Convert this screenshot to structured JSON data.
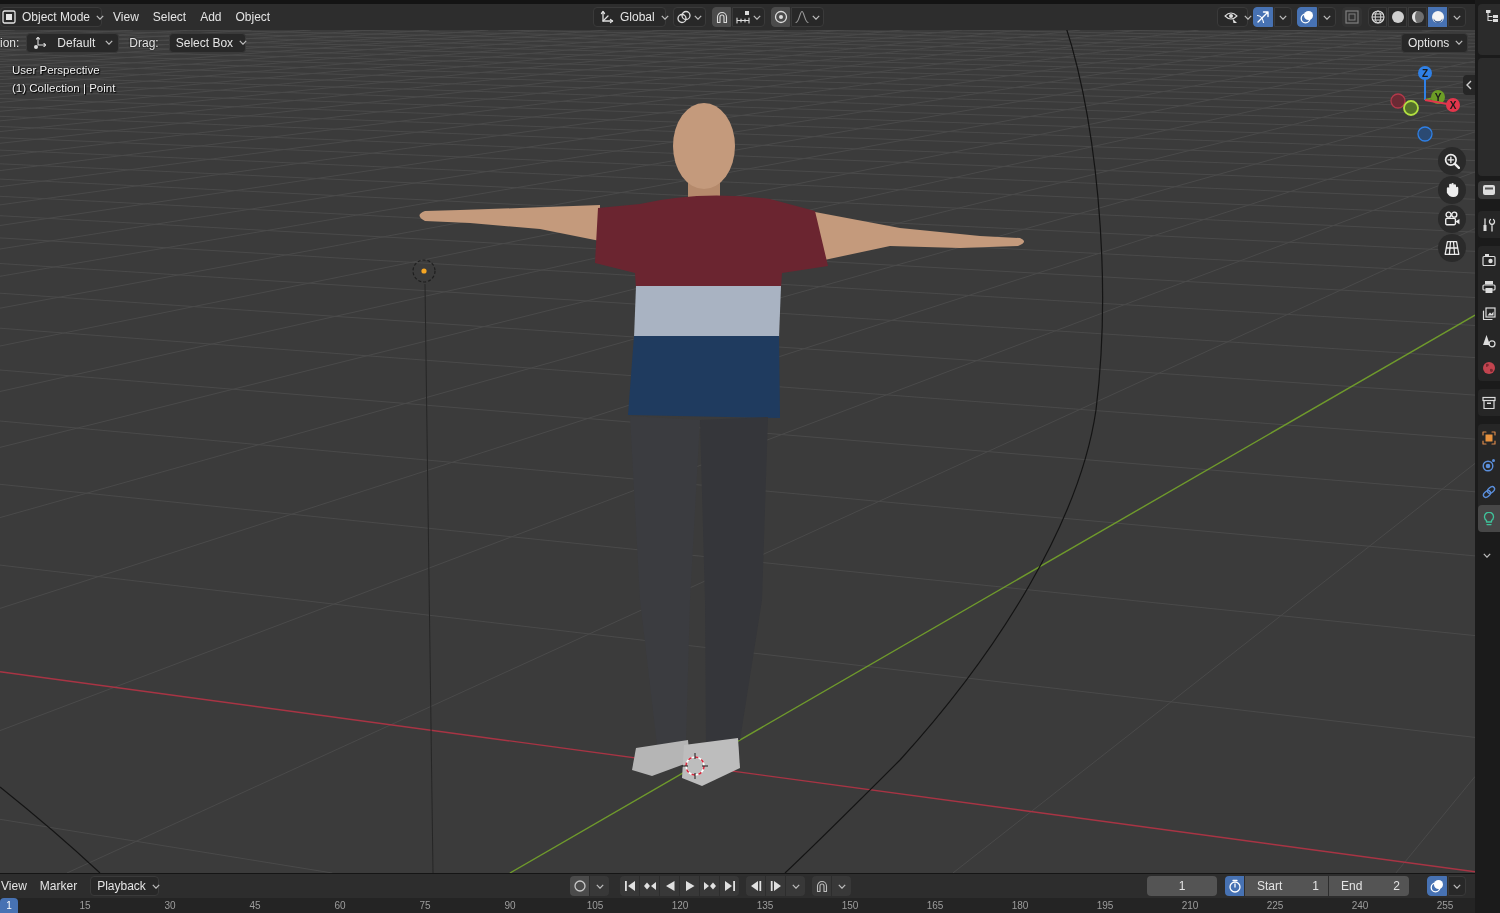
{
  "header": {
    "mode": "Object Mode",
    "menus": [
      "View",
      "Select",
      "Add",
      "Object"
    ],
    "orientation": "Global",
    "snap": {
      "on": false
    },
    "proportional_editing": {
      "on": false
    },
    "gizmos": {
      "on": true
    },
    "overlays": {
      "on": true
    },
    "xray": {
      "on": false
    },
    "shading": [
      {
        "kind": "wireframe",
        "selected": false
      },
      {
        "kind": "solid",
        "selected": false
      },
      {
        "kind": "material",
        "selected": false
      },
      {
        "kind": "rendered",
        "selected": true
      }
    ]
  },
  "tool_settings": {
    "orientation_label": "ion:",
    "pivot": "Default",
    "drag_label": "Drag:",
    "drag": "Select Box",
    "options": "Options"
  },
  "viewport": {
    "view_name": "User Perspective",
    "object_info": "(1) Collection | Point"
  },
  "navigation_gizmo": {
    "axes": [
      {
        "kind": "z",
        "label": "Z"
      },
      {
        "kind": "y",
        "label": "Y"
      },
      {
        "kind": "x",
        "label": "X"
      }
    ]
  },
  "properties_tabs": [
    {
      "kind": "tool",
      "selected": false
    },
    {
      "kind": "render",
      "selected": false
    },
    {
      "kind": "output",
      "selected": false
    },
    {
      "kind": "view_layer",
      "selected": false
    },
    {
      "kind": "scene",
      "selected": false
    },
    {
      "kind": "world",
      "selected": false
    },
    {
      "kind": "collection",
      "selected": false
    },
    {
      "kind": "object",
      "selected": false
    },
    {
      "kind": "physics",
      "selected": false
    },
    {
      "kind": "constraints",
      "selected": false
    },
    {
      "kind": "data",
      "selected": true
    }
  ],
  "timeline": {
    "menus": [
      "View",
      "Marker"
    ],
    "playback": "Playback",
    "auto_keying": {
      "on": false
    },
    "current_frame": "1",
    "preview_range": {
      "on": true
    },
    "start_label": "Start",
    "start": "1",
    "end_label": "End",
    "end": "2",
    "overlays": {
      "on": true
    }
  },
  "ruler": {
    "current": "1",
    "labels": [
      "15",
      "30",
      "45",
      "60",
      "75",
      "90",
      "105",
      "120",
      "135",
      "150",
      "165",
      "180",
      "195",
      "210",
      "225",
      "240",
      "255"
    ]
  }
}
